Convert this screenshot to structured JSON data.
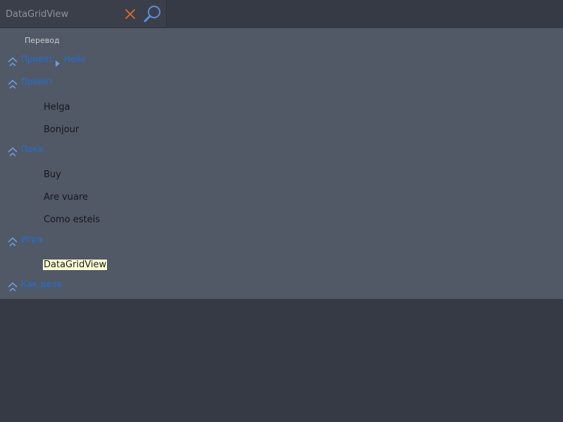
{
  "search": {
    "value": "DataGridView",
    "clear_icon": "close-icon",
    "search_icon": "magnifier-icon",
    "clear_color": "#e0692e",
    "search_color": "#5b8fd8"
  },
  "grid": {
    "column_header": "Перевод",
    "breadcrumb": {
      "parent": "Привет",
      "current": "Hello"
    },
    "groups": [
      {
        "label": "Привет",
        "items": [
          "Helga",
          "Bonjour"
        ]
      },
      {
        "label": "Пока",
        "items": [
          "Buy",
          "Are vuare",
          "Como esteis"
        ]
      },
      {
        "label": "Игра",
        "items": [
          "DataGridView"
        ]
      },
      {
        "label": "Как дела",
        "items": []
      }
    ],
    "selected_item": "DataGridView",
    "link_color": "#1e6fd9",
    "selected_bg": "#ffffd2"
  }
}
